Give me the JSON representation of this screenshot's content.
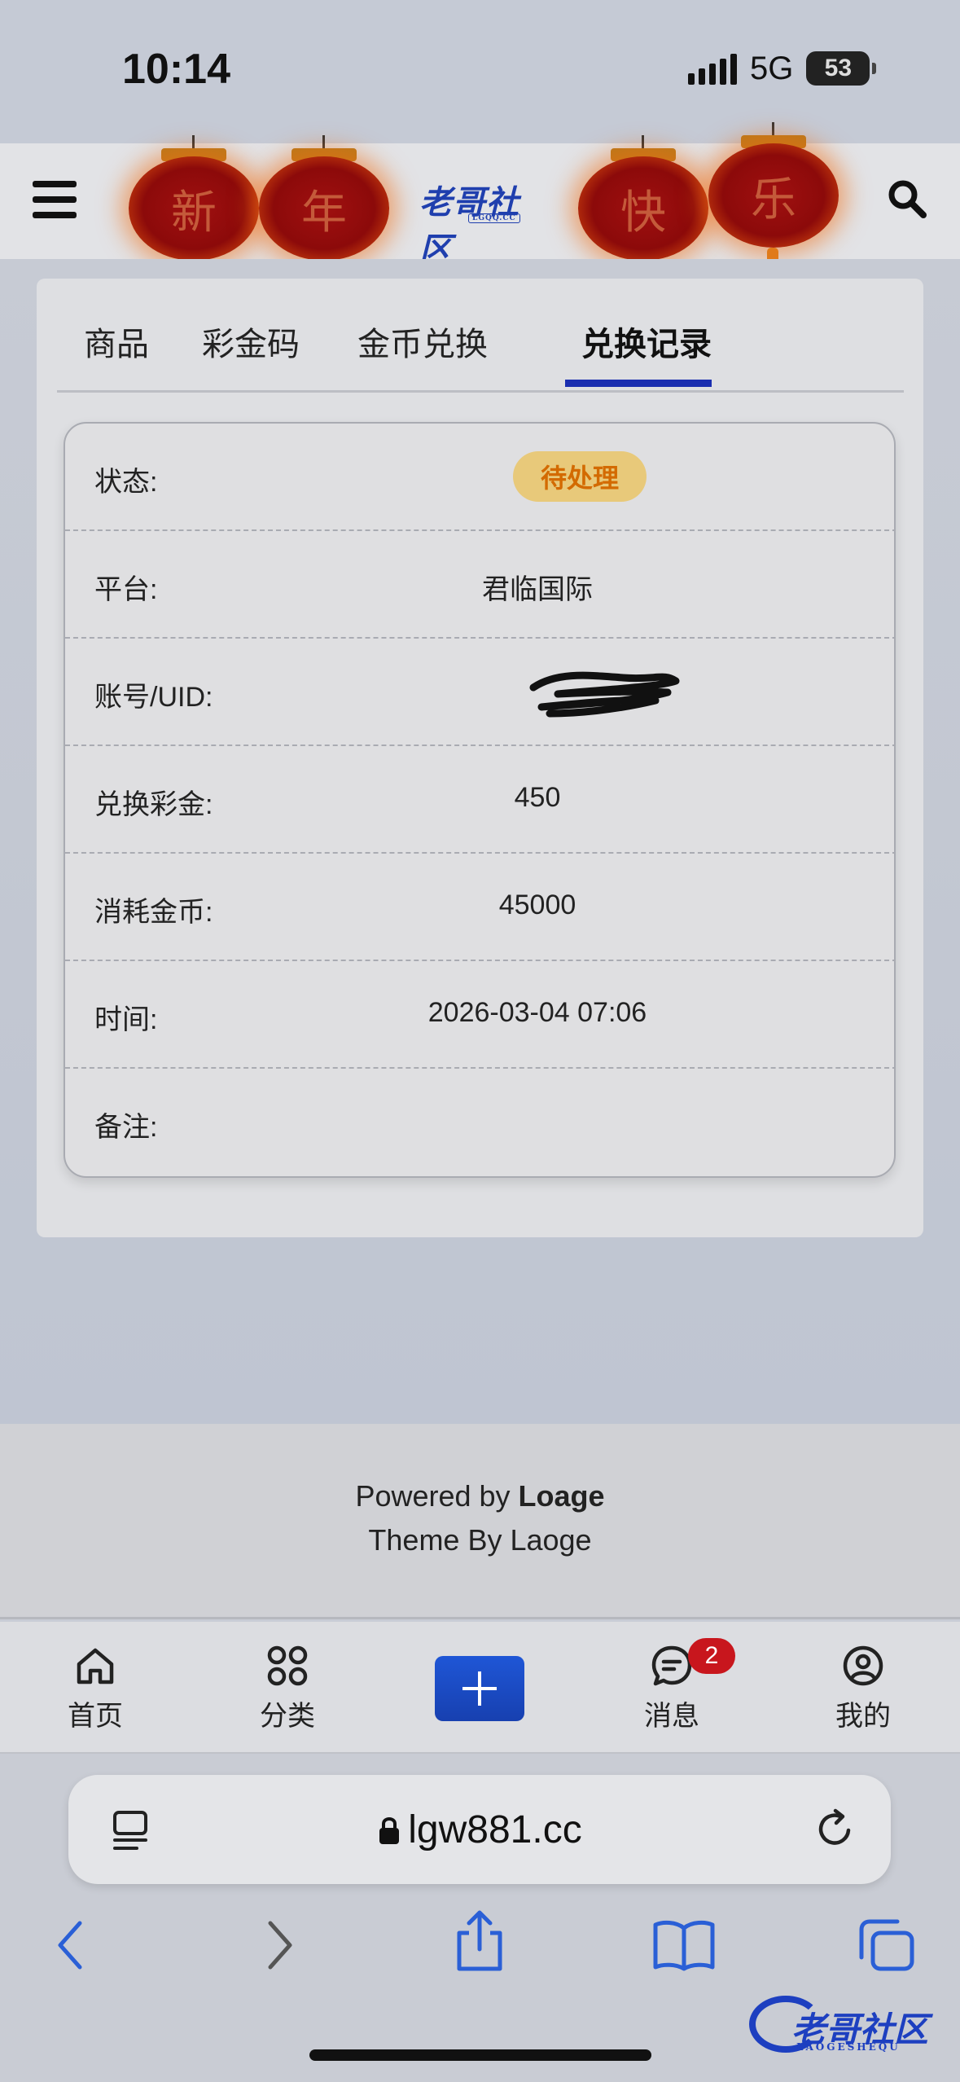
{
  "status_bar": {
    "time": "10:14",
    "network": "5G",
    "battery": "53"
  },
  "header": {
    "logo": "老哥社区",
    "logo_sub": "LGQQ.CC",
    "lanterns": [
      "新",
      "年",
      "快",
      "乐"
    ]
  },
  "tabs": [
    {
      "label": "商品"
    },
    {
      "label": "彩金码"
    },
    {
      "label": "金币兑换"
    },
    {
      "label": "兑换记录",
      "active": true
    }
  ],
  "record": {
    "status_label": "状态:",
    "status_value": "待处理",
    "platform_label": "平台:",
    "platform_value": "君临国际",
    "account_label": "账号/UID:",
    "account_value": "",
    "bonus_label": "兑换彩金:",
    "bonus_value": "450",
    "coins_label": "消耗金币:",
    "coins_value": "45000",
    "time_label": "时间:",
    "time_value": "2026-03-04 07:06",
    "note_label": "备注:",
    "note_value": ""
  },
  "footer": {
    "powered_prefix": "Powered by ",
    "powered_name": "Loage",
    "theme": "Theme By Laoge"
  },
  "tabbar": {
    "home": "首页",
    "category": "分类",
    "messages": "消息",
    "messages_badge": "2",
    "profile": "我的"
  },
  "browser": {
    "url": "lgw881.cc"
  },
  "watermark": {
    "text": "老哥社区",
    "sub": "LAOGESHEQU"
  },
  "colors": {
    "accent": "#1a2eb0",
    "badge_bg": "#e8c97a",
    "badge_text": "#d36a00",
    "notification": "#c8161d"
  }
}
